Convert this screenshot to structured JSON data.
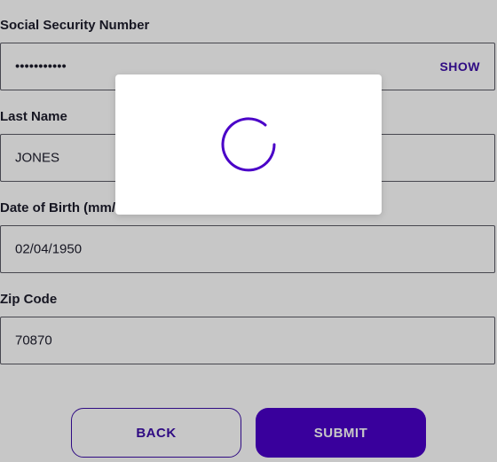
{
  "form": {
    "ssn": {
      "label": "Social Security Number",
      "value": "•••••••••••",
      "show_label": "SHOW"
    },
    "last_name": {
      "label": "Last Name",
      "value": "JONES"
    },
    "dob": {
      "label": "Date of Birth (mm/dd/yyyy)",
      "value": "02/04/1950"
    },
    "zip": {
      "label": "Zip Code",
      "value": "70870"
    }
  },
  "buttons": {
    "back_label": "BACK",
    "submit_label": "SUBMIT"
  },
  "colors": {
    "accent": "#4a00c8",
    "accent_text": "#3d0fa8",
    "overlay": "rgba(0,0,0,0.22)"
  },
  "loading": {
    "icon": "spinner-icon"
  }
}
